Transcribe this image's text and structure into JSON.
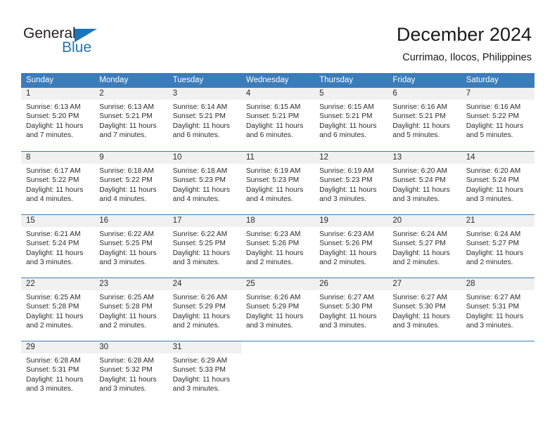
{
  "brand": {
    "name_part1": "General",
    "name_part2": "Blue",
    "logo_icon": "triangle-icon"
  },
  "header": {
    "title": "December 2024",
    "subtitle": "Currimao, Ilocos, Philippines"
  },
  "colors": {
    "header_blue": "#3b7cba",
    "brand_blue": "#1b75bb",
    "daynum_band": "#f0f0f0",
    "text": "#2b2b2b"
  },
  "weekdays": [
    "Sunday",
    "Monday",
    "Tuesday",
    "Wednesday",
    "Thursday",
    "Friday",
    "Saturday"
  ],
  "weeks": [
    [
      {
        "day": "1",
        "sunrise": "Sunrise: 6:13 AM",
        "sunset": "Sunset: 5:20 PM",
        "daylight1": "Daylight: 11 hours",
        "daylight2": "and 7 minutes."
      },
      {
        "day": "2",
        "sunrise": "Sunrise: 6:13 AM",
        "sunset": "Sunset: 5:21 PM",
        "daylight1": "Daylight: 11 hours",
        "daylight2": "and 7 minutes."
      },
      {
        "day": "3",
        "sunrise": "Sunrise: 6:14 AM",
        "sunset": "Sunset: 5:21 PM",
        "daylight1": "Daylight: 11 hours",
        "daylight2": "and 6 minutes."
      },
      {
        "day": "4",
        "sunrise": "Sunrise: 6:15 AM",
        "sunset": "Sunset: 5:21 PM",
        "daylight1": "Daylight: 11 hours",
        "daylight2": "and 6 minutes."
      },
      {
        "day": "5",
        "sunrise": "Sunrise: 6:15 AM",
        "sunset": "Sunset: 5:21 PM",
        "daylight1": "Daylight: 11 hours",
        "daylight2": "and 6 minutes."
      },
      {
        "day": "6",
        "sunrise": "Sunrise: 6:16 AM",
        "sunset": "Sunset: 5:21 PM",
        "daylight1": "Daylight: 11 hours",
        "daylight2": "and 5 minutes."
      },
      {
        "day": "7",
        "sunrise": "Sunrise: 6:16 AM",
        "sunset": "Sunset: 5:22 PM",
        "daylight1": "Daylight: 11 hours",
        "daylight2": "and 5 minutes."
      }
    ],
    [
      {
        "day": "8",
        "sunrise": "Sunrise: 6:17 AM",
        "sunset": "Sunset: 5:22 PM",
        "daylight1": "Daylight: 11 hours",
        "daylight2": "and 4 minutes."
      },
      {
        "day": "9",
        "sunrise": "Sunrise: 6:18 AM",
        "sunset": "Sunset: 5:22 PM",
        "daylight1": "Daylight: 11 hours",
        "daylight2": "and 4 minutes."
      },
      {
        "day": "10",
        "sunrise": "Sunrise: 6:18 AM",
        "sunset": "Sunset: 5:23 PM",
        "daylight1": "Daylight: 11 hours",
        "daylight2": "and 4 minutes."
      },
      {
        "day": "11",
        "sunrise": "Sunrise: 6:19 AM",
        "sunset": "Sunset: 5:23 PM",
        "daylight1": "Daylight: 11 hours",
        "daylight2": "and 4 minutes."
      },
      {
        "day": "12",
        "sunrise": "Sunrise: 6:19 AM",
        "sunset": "Sunset: 5:23 PM",
        "daylight1": "Daylight: 11 hours",
        "daylight2": "and 3 minutes."
      },
      {
        "day": "13",
        "sunrise": "Sunrise: 6:20 AM",
        "sunset": "Sunset: 5:24 PM",
        "daylight1": "Daylight: 11 hours",
        "daylight2": "and 3 minutes."
      },
      {
        "day": "14",
        "sunrise": "Sunrise: 6:20 AM",
        "sunset": "Sunset: 5:24 PM",
        "daylight1": "Daylight: 11 hours",
        "daylight2": "and 3 minutes."
      }
    ],
    [
      {
        "day": "15",
        "sunrise": "Sunrise: 6:21 AM",
        "sunset": "Sunset: 5:24 PM",
        "daylight1": "Daylight: 11 hours",
        "daylight2": "and 3 minutes."
      },
      {
        "day": "16",
        "sunrise": "Sunrise: 6:22 AM",
        "sunset": "Sunset: 5:25 PM",
        "daylight1": "Daylight: 11 hours",
        "daylight2": "and 3 minutes."
      },
      {
        "day": "17",
        "sunrise": "Sunrise: 6:22 AM",
        "sunset": "Sunset: 5:25 PM",
        "daylight1": "Daylight: 11 hours",
        "daylight2": "and 3 minutes."
      },
      {
        "day": "18",
        "sunrise": "Sunrise: 6:23 AM",
        "sunset": "Sunset: 5:26 PM",
        "daylight1": "Daylight: 11 hours",
        "daylight2": "and 2 minutes."
      },
      {
        "day": "19",
        "sunrise": "Sunrise: 6:23 AM",
        "sunset": "Sunset: 5:26 PM",
        "daylight1": "Daylight: 11 hours",
        "daylight2": "and 2 minutes."
      },
      {
        "day": "20",
        "sunrise": "Sunrise: 6:24 AM",
        "sunset": "Sunset: 5:27 PM",
        "daylight1": "Daylight: 11 hours",
        "daylight2": "and 2 minutes."
      },
      {
        "day": "21",
        "sunrise": "Sunrise: 6:24 AM",
        "sunset": "Sunset: 5:27 PM",
        "daylight1": "Daylight: 11 hours",
        "daylight2": "and 2 minutes."
      }
    ],
    [
      {
        "day": "22",
        "sunrise": "Sunrise: 6:25 AM",
        "sunset": "Sunset: 5:28 PM",
        "daylight1": "Daylight: 11 hours",
        "daylight2": "and 2 minutes."
      },
      {
        "day": "23",
        "sunrise": "Sunrise: 6:25 AM",
        "sunset": "Sunset: 5:28 PM",
        "daylight1": "Daylight: 11 hours",
        "daylight2": "and 2 minutes."
      },
      {
        "day": "24",
        "sunrise": "Sunrise: 6:26 AM",
        "sunset": "Sunset: 5:29 PM",
        "daylight1": "Daylight: 11 hours",
        "daylight2": "and 2 minutes."
      },
      {
        "day": "25",
        "sunrise": "Sunrise: 6:26 AM",
        "sunset": "Sunset: 5:29 PM",
        "daylight1": "Daylight: 11 hours",
        "daylight2": "and 3 minutes."
      },
      {
        "day": "26",
        "sunrise": "Sunrise: 6:27 AM",
        "sunset": "Sunset: 5:30 PM",
        "daylight1": "Daylight: 11 hours",
        "daylight2": "and 3 minutes."
      },
      {
        "day": "27",
        "sunrise": "Sunrise: 6:27 AM",
        "sunset": "Sunset: 5:30 PM",
        "daylight1": "Daylight: 11 hours",
        "daylight2": "and 3 minutes."
      },
      {
        "day": "28",
        "sunrise": "Sunrise: 6:27 AM",
        "sunset": "Sunset: 5:31 PM",
        "daylight1": "Daylight: 11 hours",
        "daylight2": "and 3 minutes."
      }
    ],
    [
      {
        "day": "29",
        "sunrise": "Sunrise: 6:28 AM",
        "sunset": "Sunset: 5:31 PM",
        "daylight1": "Daylight: 11 hours",
        "daylight2": "and 3 minutes."
      },
      {
        "day": "30",
        "sunrise": "Sunrise: 6:28 AM",
        "sunset": "Sunset: 5:32 PM",
        "daylight1": "Daylight: 11 hours",
        "daylight2": "and 3 minutes."
      },
      {
        "day": "31",
        "sunrise": "Sunrise: 6:29 AM",
        "sunset": "Sunset: 5:33 PM",
        "daylight1": "Daylight: 11 hours",
        "daylight2": "and 3 minutes."
      },
      {
        "day": "",
        "sunrise": "",
        "sunset": "",
        "daylight1": "",
        "daylight2": ""
      },
      {
        "day": "",
        "sunrise": "",
        "sunset": "",
        "daylight1": "",
        "daylight2": ""
      },
      {
        "day": "",
        "sunrise": "",
        "sunset": "",
        "daylight1": "",
        "daylight2": ""
      },
      {
        "day": "",
        "sunrise": "",
        "sunset": "",
        "daylight1": "",
        "daylight2": ""
      }
    ]
  ]
}
